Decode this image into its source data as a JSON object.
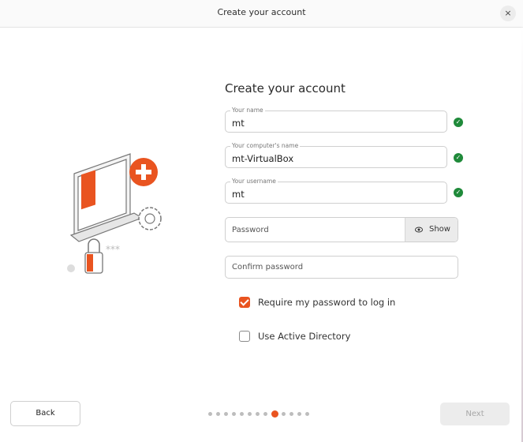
{
  "window": {
    "title": "Create your account",
    "close_label": "×"
  },
  "form": {
    "heading": "Create your account",
    "your_name": {
      "label": "Your name",
      "value": "mt"
    },
    "computer_name": {
      "label": "Your computer's name",
      "value": "mt-VirtualBox"
    },
    "username": {
      "label": "Your username",
      "value": "mt"
    },
    "password": {
      "placeholder": "Password",
      "show_label": "Show"
    },
    "confirm_password": {
      "placeholder": "Confirm password"
    },
    "require_password": {
      "label": "Require my password to log in",
      "checked": true
    },
    "active_directory": {
      "label": "Use Active Directory",
      "checked": false
    }
  },
  "footer": {
    "back_label": "Back",
    "next_label": "Next",
    "steps_total": 13,
    "steps_current": 9
  },
  "colors": {
    "accent": "#e95420",
    "valid": "#1f8a3a"
  },
  "icons": [
    "close-icon",
    "check-icon",
    "eye-icon"
  ]
}
